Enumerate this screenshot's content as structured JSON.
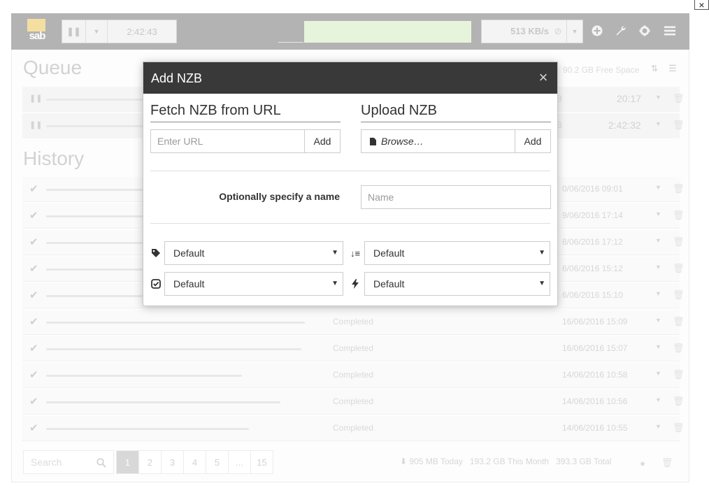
{
  "topbar": {
    "logo_text": "sab",
    "time_left": "2:42:43",
    "speed": "513 KB/s",
    "icons": [
      "pause-icon",
      "caret-down-icon",
      "link-icon",
      "plus-circle-icon",
      "wrench-icon",
      "gear-icon",
      "menu-icon"
    ]
  },
  "queue": {
    "title": "Queue",
    "free_space": "90.2 GB Free Space",
    "rows": [
      {
        "size": "B",
        "time": "20:17"
      },
      {
        "size": "B",
        "time": "2:42:32"
      }
    ]
  },
  "history": {
    "title": "History",
    "rows": [
      {
        "status": "",
        "date": "0/06/2016 09:01"
      },
      {
        "status": "",
        "date": "9/06/2016 17:14"
      },
      {
        "status": "",
        "date": "8/06/2016 17:12"
      },
      {
        "status": "",
        "date": "6/06/2016 15:12"
      },
      {
        "status": "",
        "date": "6/06/2016 15:10"
      },
      {
        "status": "Completed",
        "date": "16/06/2016 15:09"
      },
      {
        "status": "Completed",
        "date": "16/06/2016 15:07"
      },
      {
        "status": "Completed",
        "date": "14/06/2016 10:58"
      },
      {
        "status": "Completed",
        "date": "14/06/2016 10:56"
      },
      {
        "status": "Completed",
        "date": "14/06/2016 10:55"
      }
    ]
  },
  "footer": {
    "search_placeholder": "Search",
    "pages": [
      "1",
      "2",
      "3",
      "4",
      "5",
      "...",
      "15"
    ],
    "active_page": "1",
    "today": "905 MB Today",
    "month": "193.2 GB This Month",
    "total": "393.3 GB Total"
  },
  "modal": {
    "title": "Add NZB",
    "close": "×",
    "fetch_title": "Fetch NZB from URL",
    "url_placeholder": "Enter URL",
    "add_label": "Add",
    "upload_title": "Upload NZB",
    "browse_label": "Browse…",
    "name_label": "Optionally specify a name",
    "name_placeholder": "Name",
    "category": "Default",
    "priority": "Default",
    "processing": "Default",
    "script": "Default"
  },
  "window_close": "×"
}
